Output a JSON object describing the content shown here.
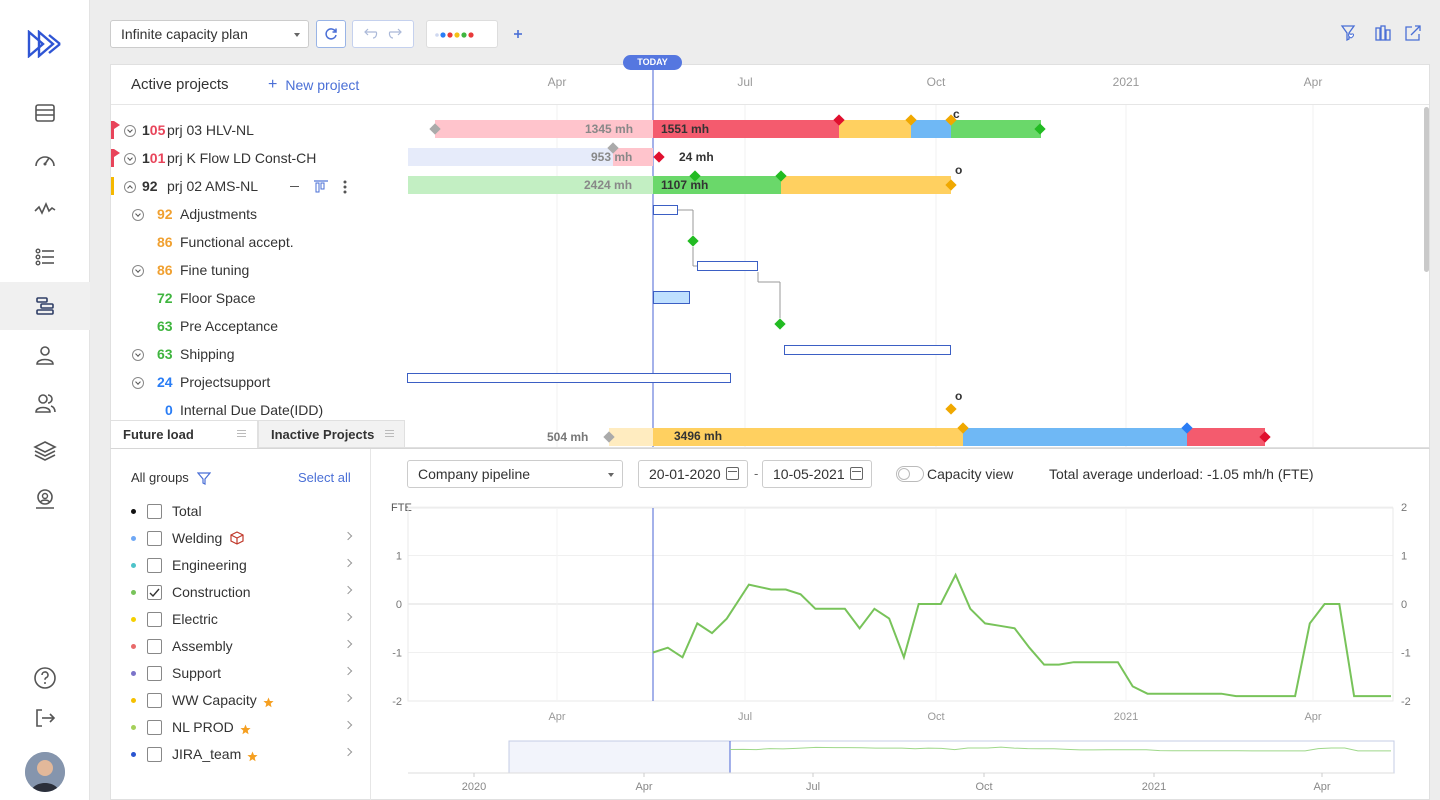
{
  "nav": {
    "items": [
      {
        "name": "table-icon",
        "active": false
      },
      {
        "name": "dashboard-icon",
        "active": false
      },
      {
        "name": "activity-icon",
        "active": false
      },
      {
        "name": "list-icon",
        "active": false
      },
      {
        "name": "gantt-icon",
        "active": true
      },
      {
        "name": "user-icon",
        "active": false
      },
      {
        "name": "users-icon",
        "active": false
      },
      {
        "name": "layers-icon",
        "active": false
      },
      {
        "name": "search-users-icon",
        "active": false
      }
    ],
    "bottom": [
      "help-icon",
      "logout-icon",
      "avatar"
    ]
  },
  "toolbar": {
    "plan_select": "Infinite capacity plan",
    "refresh_icon": "refresh-icon",
    "undo_icon": "undo-icon",
    "redo_icon": "redo-icon",
    "color_dots": [
      "#cfd8f0",
      "#2a7df5",
      "#e83a3a",
      "#f5c016",
      "#3fb53f",
      "#e83a3a"
    ],
    "add_icon": "plus-icon",
    "right_icons": [
      "filter-heart-icon",
      "columns-icon",
      "export-icon"
    ]
  },
  "gantt": {
    "header_title": "Active projects",
    "new_project": "New project",
    "today_label": "TODAY",
    "timeline_labels": [
      "Apr",
      "Jul",
      "Oct",
      "2021",
      "Apr"
    ],
    "rows": [
      {
        "num_prefix": "1",
        "num_suffix": "05",
        "name": "prj 03 HLV-NL",
        "level": 0,
        "flag": "#e8445a",
        "toggle": "down"
      },
      {
        "num_prefix": "1",
        "num_suffix": "01",
        "name": "prj K Flow LD Const-CH",
        "level": 0,
        "flag": "#e8445a",
        "toggle": "down"
      },
      {
        "num_prefix": "92",
        "num_suffix": "",
        "name": "prj 02 AMS-NL",
        "level": 0,
        "flag": "#f5b800",
        "toggle": "up"
      },
      {
        "num": "92",
        "name": "Adjustments",
        "level": 1,
        "color": "#f0a030",
        "toggle": "down"
      },
      {
        "num": "86",
        "name": "Functional accept.",
        "level": 1,
        "color": "#f0a030",
        "toggle": ""
      },
      {
        "num": "86",
        "name": "Fine tuning",
        "level": 1,
        "color": "#f0a030",
        "toggle": "down"
      },
      {
        "num": "72",
        "name": "Floor Space",
        "level": 1,
        "color": "#3fb53f",
        "toggle": ""
      },
      {
        "num": "63",
        "name": "Pre Acceptance",
        "level": 1,
        "color": "#3fb53f",
        "toggle": ""
      },
      {
        "num": "63",
        "name": "Shipping",
        "level": 1,
        "color": "#3fb53f",
        "toggle": "down"
      },
      {
        "num": "24",
        "name": "Projectsupport",
        "level": 1,
        "color": "#2a7df5",
        "toggle": "down"
      },
      {
        "num": "0",
        "name": "Internal Due Date(IDD)",
        "level": 1,
        "color": "#2a7df5",
        "toggle": ""
      }
    ],
    "bar_labels": {
      "r1_past": "1345 mh",
      "r1_future": "1551 mh",
      "r2_past": "953 mh",
      "r2_extra": "24 mh",
      "r3_past": "2424 mh",
      "r3_future": "1107 mh",
      "r4_past": "504 mh",
      "r4_future": "3496 mh"
    },
    "marker_letters": [
      "c",
      "o",
      "o"
    ]
  },
  "tabs": [
    {
      "label": "Future load",
      "active": true
    },
    {
      "label": "Inactive Projects",
      "active": false
    }
  ],
  "groups": {
    "header": "All groups",
    "select_all": "Select all",
    "items": [
      {
        "label": "Total",
        "dot": "#111111",
        "checked": false,
        "badge": ""
      },
      {
        "label": "Welding",
        "dot": "#6fa8f5",
        "checked": false,
        "badge": "box"
      },
      {
        "label": "Engineering",
        "dot": "#4ec3c9",
        "checked": false,
        "badge": ""
      },
      {
        "label": "Construction",
        "dot": "#78c35a",
        "checked": true,
        "badge": ""
      },
      {
        "label": "Electric",
        "dot": "#f5d000",
        "checked": false,
        "badge": ""
      },
      {
        "label": "Assembly",
        "dot": "#e86a6a",
        "checked": false,
        "badge": ""
      },
      {
        "label": "Support",
        "dot": "#7b73c9",
        "checked": false,
        "badge": ""
      },
      {
        "label": "WW Capacity",
        "dot": "#f5c000",
        "checked": false,
        "badge": "star"
      },
      {
        "label": "NL PROD",
        "dot": "#a5d05a",
        "checked": false,
        "badge": "star"
      },
      {
        "label": "JIRA_team",
        "dot": "#2a55d0",
        "checked": false,
        "badge": "star"
      }
    ]
  },
  "load": {
    "pipeline_select": "Company pipeline",
    "date_from": "20-01-2020",
    "date_sep": "-",
    "date_to": "10-05-2021",
    "capacity_view": "Capacity view",
    "underload_text": "Total average underload: -1.05 mh/h (FTE)"
  },
  "chart_data": {
    "type": "line",
    "ylabel": "FTE",
    "ylim": [
      -2,
      2
    ],
    "yticks_left": [
      "1",
      "0",
      "-1",
      "-2"
    ],
    "yticks_right": [
      "2",
      "1",
      "0",
      "-1",
      "-2"
    ],
    "x_tick_labels": [
      "Apr",
      "Jul",
      "Oct",
      "2021",
      "Apr"
    ],
    "series": [
      {
        "color": "#78c35a",
        "x": [
          0,
          0.02,
          0.04,
          0.06,
          0.08,
          0.1,
          0.13,
          0.16,
          0.18,
          0.2,
          0.22,
          0.24,
          0.26,
          0.28,
          0.3,
          0.32,
          0.34,
          0.36,
          0.38,
          0.39,
          0.41,
          0.43,
          0.45,
          0.47,
          0.49,
          0.51,
          0.53,
          0.55,
          0.57,
          0.59,
          0.61,
          0.63,
          0.65,
          0.67,
          0.69,
          0.71,
          0.73,
          0.75,
          0.77,
          0.79,
          0.81,
          0.83,
          0.85,
          0.87,
          0.89,
          0.91,
          0.93,
          0.95,
          0.97,
          0.99,
          1
        ],
        "values": [
          -1.0,
          -0.9,
          -1.1,
          -0.4,
          -0.6,
          -0.3,
          0.4,
          0.3,
          0.3,
          0.2,
          -0.1,
          -0.1,
          -0.1,
          -0.5,
          -0.1,
          -0.3,
          -1.1,
          0.0,
          0.0,
          0.0,
          0.6,
          -0.1,
          -0.4,
          -0.45,
          -0.5,
          -0.9,
          -1.25,
          -1.25,
          -1.2,
          -1.2,
          -1.2,
          -1.2,
          -1.7,
          -1.85,
          -1.85,
          -1.85,
          -1.85,
          -1.85,
          -1.85,
          -1.9,
          -1.9,
          -1.9,
          -1.9,
          -1.9,
          -0.4,
          0.0,
          0.0,
          -1.9,
          -1.9,
          -1.9,
          -1.9
        ]
      }
    ],
    "mini_x_labels": [
      "2020",
      "Apr",
      "Jul",
      "Oct",
      "2021",
      "Apr"
    ]
  }
}
